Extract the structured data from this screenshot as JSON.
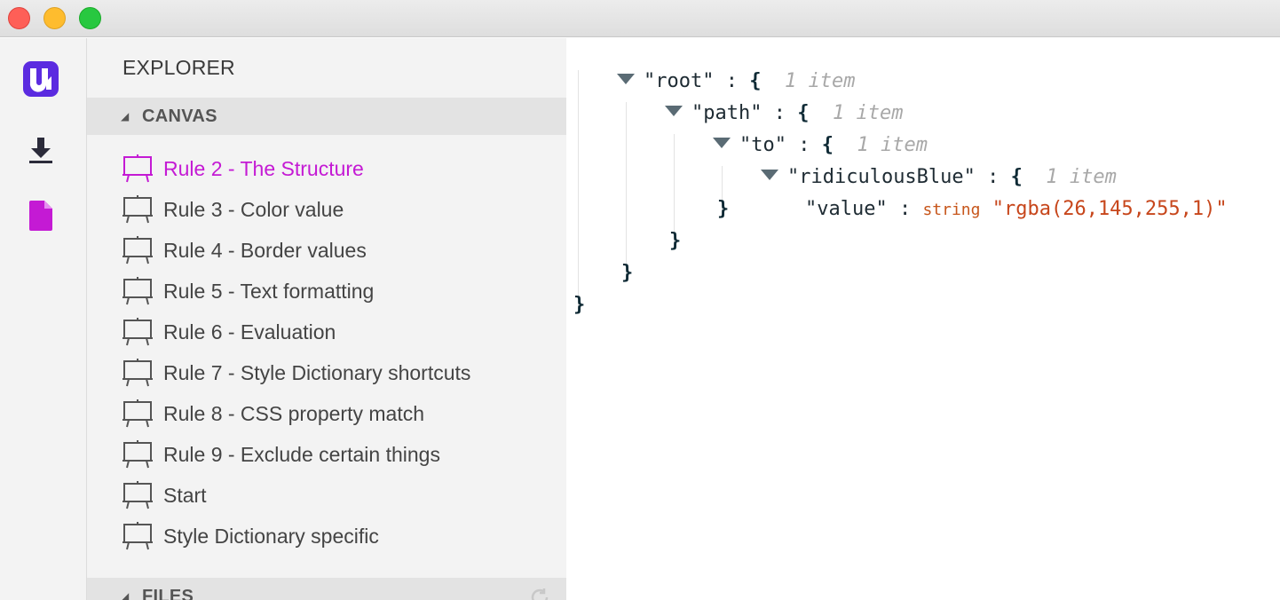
{
  "activity": {
    "icons": [
      "app-logo-icon",
      "download-icon",
      "file-icon"
    ],
    "colors": {
      "logo": "#5b2be0",
      "download": "#2b2b3a",
      "file": "#c41ad4"
    }
  },
  "sidebar": {
    "title": "EXPLORER",
    "canvas_section": "CANVAS",
    "files_section": "FILES",
    "items": [
      {
        "label": "Rule 2 - The Structure",
        "active": true
      },
      {
        "label": "Rule 3 - Color value"
      },
      {
        "label": "Rule 4 - Border values"
      },
      {
        "label": "Rule 5 - Text formatting"
      },
      {
        "label": "Rule 6 - Evaluation"
      },
      {
        "label": "Rule 7 - Style Dictionary shortcuts"
      },
      {
        "label": "Rule 8 - CSS property match"
      },
      {
        "label": "Rule 9 - Exclude certain things"
      },
      {
        "label": "Start"
      },
      {
        "label": "Style Dictionary specific"
      }
    ]
  },
  "json": {
    "root_key": "\"root\"",
    "path_key": "\"path\"",
    "to_key": "\"to\"",
    "blue_key": "\"ridiculousBlue\"",
    "value_key": "\"value\"",
    "colon": " : ",
    "open_brace": "{",
    "close_brace": "}",
    "count": "1 item",
    "type": "string",
    "value": "\"rgba(26,145,255,1)\""
  }
}
